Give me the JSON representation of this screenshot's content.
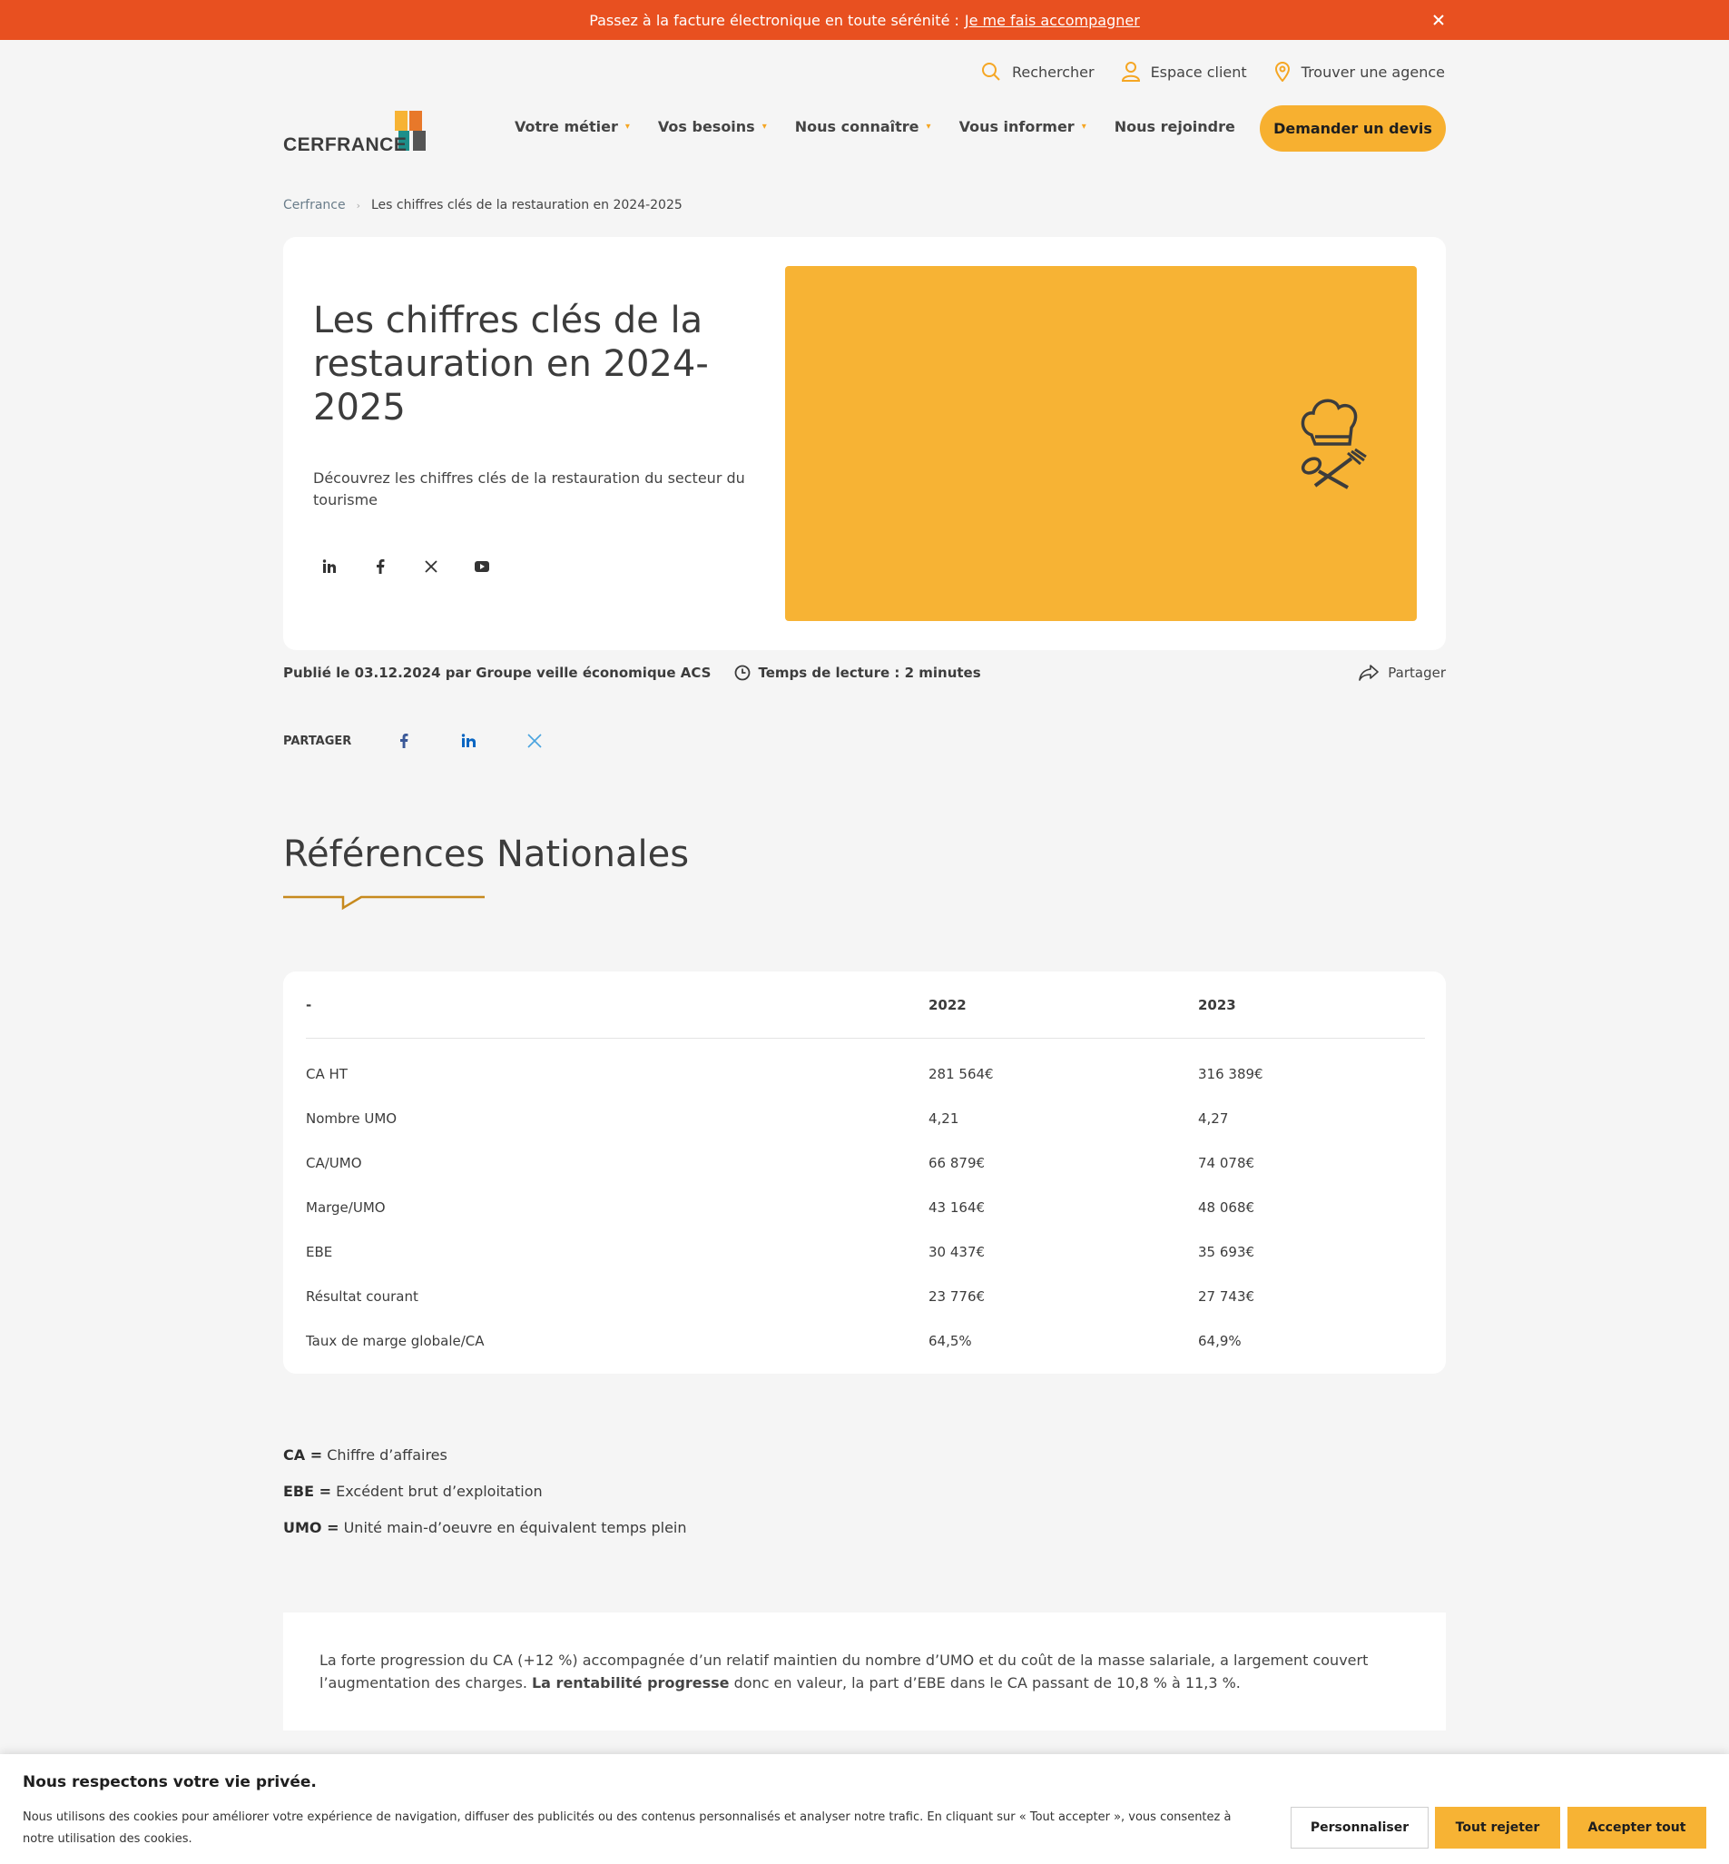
{
  "banner": {
    "text": "Passez à la facture électronique en toute sérénité :",
    "link": "Je me fais accompagner",
    "close_icon": "close-icon"
  },
  "utility": {
    "search": "Rechercher",
    "client": "Espace client",
    "agency": "Trouver une agence"
  },
  "logo": {
    "text": "CERFRANCE"
  },
  "nav": {
    "items": [
      "Votre métier",
      "Vos besoins",
      "Nous connaître",
      "Vous informer",
      "Nous rejoindre"
    ],
    "cta": "Demander un devis"
  },
  "breadcrumb": {
    "home": "Cerfrance",
    "current": "Les chiffres clés de la restauration en 2024-2025"
  },
  "hero": {
    "title": "Les chiffres clés de la restauration en 2024-2025",
    "subtitle": "Découvrez les chiffres clés de la restauration du secteur du tourisme",
    "image_color": "#f7b334",
    "image_icon": "chef-hat-utensils-icon"
  },
  "meta": {
    "published": "Publié le 03.12.2024 par  Groupe veille économique ACS",
    "reading": "Temps de lecture : 2 minutes",
    "share": "Partager"
  },
  "sharebar": {
    "label": "PARTAGER"
  },
  "section": {
    "title": "Références Nationales"
  },
  "table": {
    "headers": [
      "-",
      "2022",
      "2023"
    ],
    "rows": [
      [
        "CA HT",
        "281 564€",
        "316 389€"
      ],
      [
        "Nombre UMO",
        "4,21",
        "4,27"
      ],
      [
        "CA/UMO",
        "66 879€",
        "74 078€"
      ],
      [
        "Marge/UMO",
        "43 164€",
        "48 068€"
      ],
      [
        "EBE",
        "30 437€",
        "35 693€"
      ],
      [
        "Résultat courant",
        "23 776€",
        "27 743€"
      ],
      [
        "Taux de marge globale/CA",
        "64,5%",
        "64,9%"
      ]
    ]
  },
  "notes": [
    {
      "term": "CA =",
      "def": " Chiffre d’affaires"
    },
    {
      "term": "EBE =",
      "def": " Excédent brut d’exploitation"
    },
    {
      "term": "UMO =",
      "def": " Unité main-d’oeuvre en équivalent temps plein"
    }
  ],
  "summary": {
    "before": "La forte progression du CA (+12 %) accompagnée d’un relatif maintien du nombre d’UMO et du coût de la masse salariale, a largement couvert l’augmentation des charges. ",
    "bold": "La rentabilité progresse",
    "after": " donc en valeur, la part d’EBE dans le CA passant de 10,8 % à 11,3 %."
  },
  "cookie": {
    "title": "Nous respectons votre vie privée.",
    "text": "Nous utilisons des cookies pour améliorer votre expérience de navigation, diffuser des publicités ou des contenus personnalisés et analyser notre trafic. En cliquant sur « Tout accepter », vous consentez à notre utilisation des cookies.",
    "customize": "Personnaliser",
    "reject": "Tout rejeter",
    "accept": "Accepter tout"
  },
  "colors": {
    "accent": "#f7b334",
    "banner": "#e85020"
  }
}
